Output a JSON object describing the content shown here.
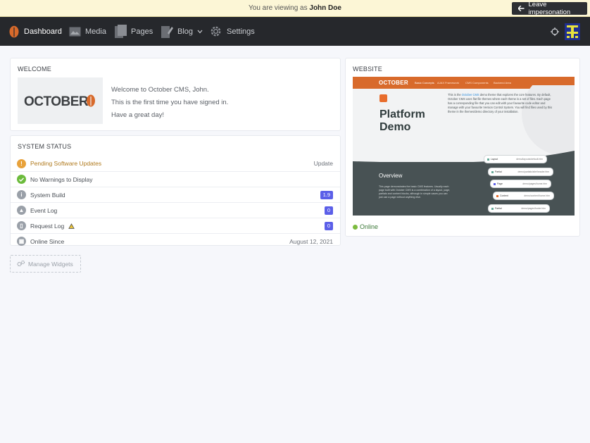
{
  "impersonation": {
    "prefix": "You are viewing as",
    "user": "John Doe",
    "leave_label": "Leave impersonation"
  },
  "nav": {
    "items": [
      {
        "label": "Dashboard",
        "icon": "october-leaf-icon"
      },
      {
        "label": "Media",
        "icon": "image-icon"
      },
      {
        "label": "Pages",
        "icon": "pages-icon"
      },
      {
        "label": "Blog",
        "icon": "blog-pencil-icon"
      },
      {
        "label": "Settings",
        "icon": "gear-icon"
      }
    ],
    "right_icons": [
      "crosshair-icon",
      "user-avatar-icon"
    ]
  },
  "welcome": {
    "title": "WELCOME",
    "logo_text": "OCTOBER",
    "lines": [
      "Welcome to October CMS, John.",
      "This is the first time you have signed in.",
      "Have a great day!"
    ]
  },
  "system_status": {
    "title": "SYSTEM STATUS",
    "rows": [
      {
        "label": "Pending Software Updates",
        "right": "Update",
        "icon": "exclamation-icon",
        "color": "#e8a23b"
      },
      {
        "label": "No Warnings to Display",
        "right": "",
        "icon": "check-icon",
        "color": "#6cbb3c"
      },
      {
        "label": "System Build",
        "badge": "1.9",
        "icon": "info-icon",
        "color": "#9aa0a8"
      },
      {
        "label": "Event Log",
        "badge": "0",
        "icon": "warning-icon",
        "color": "#9aa0a8"
      },
      {
        "label": "Request Log",
        "badge": "0",
        "icon": "file-icon",
        "color": "#9aa0a8"
      },
      {
        "label": "Online Since",
        "right": "August 12, 2021",
        "icon": "calendar-icon",
        "color": "#9aa0a8"
      }
    ]
  },
  "manage_widgets_label": "Manage Widgets",
  "website": {
    "title": "WEBSITE",
    "preview": {
      "logo": "OCTOBER",
      "nav": [
        "Basic Concepts",
        "AJAX Framework",
        "CMS Components",
        "Backend Area"
      ],
      "headline_line1": "Platform",
      "headline_line2": "Demo",
      "para_pre": "This is the",
      "para_link": "October CMS",
      "para_post": "demo theme that explores the core features. By default, October CMS uses flat file themes where each theme is a set of files. Each page has a corresponding file that you can edit with your favourite code editor and manage with your favourite Version Control System. You will find files used by this theme in the themes/demo directory of your installation.",
      "overview": "Overview",
      "overview_text": "This page demonstrates the basic CMS features. Usually each page built with October CMS is a combination of a layout, page, partials and content blocks, although in simple cases you can just use a page without anything else.",
      "chips": [
        {
          "label": "Layout",
          "path": "demo/layouts/default.htm"
        },
        {
          "label": "Partial",
          "path": "demo/partials/site/header.htm"
        },
        {
          "label": "Page",
          "path": "demo/pages/home.htm"
        },
        {
          "label": "Content",
          "path": "demo/content/home.htm"
        },
        {
          "label": "Partial",
          "path": "demo/pages/footer.htm"
        }
      ]
    },
    "status": "Online"
  },
  "colors": {
    "accent": "#d86a2b",
    "nav_bg": "#26282c",
    "badge": "#5b5fe8",
    "online": "#7cbb3f"
  }
}
